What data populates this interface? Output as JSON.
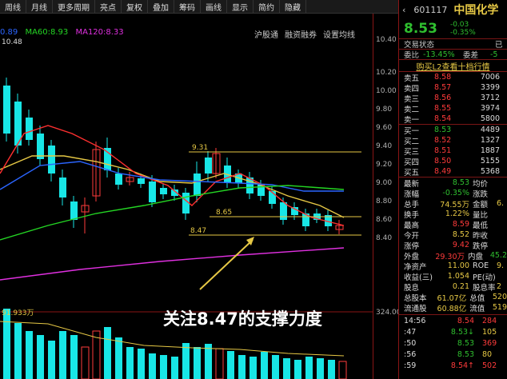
{
  "toolbar": {
    "items": [
      "周线",
      "月线",
      "更多周期",
      "亮点",
      "复权",
      "叠加",
      "筹码",
      "画线",
      "显示",
      "简约",
      "隐藏"
    ]
  },
  "indicators": {
    "ma5_value": "0.89",
    "ma60_label": "MA60:8.93",
    "ma120_label": "MA120:8.33",
    "high_marker": "10.48"
  },
  "chart_tools": [
    "沪股通",
    "融资融券",
    "设置均线"
  ],
  "price_axis": [
    "10.40",
    "10.20",
    "10.00",
    "9.80",
    "9.60",
    "9.40",
    "9.20",
    "9.00",
    "8.80",
    "8.60",
    "8.40"
  ],
  "level_labels": {
    "l931": "9.31",
    "l865": "8.65",
    "l847": "8.47"
  },
  "volume": {
    "label": "91.933万",
    "axis_top": "324.00"
  },
  "caption": {
    "text_a": "关注",
    "text_num": "8.47",
    "text_b": "的支撑力度"
  },
  "quote": {
    "code": "601117",
    "name": "中国化学",
    "last": "8.53",
    "change": "-0.03",
    "change_pct": "-0.35%",
    "status_label": "交易状态",
    "status_value": "已",
    "weibi_label": "委比",
    "weibi_value": "-13.45%",
    "weicha_label": "委差",
    "weicha_value": "-5",
    "level2_link": "购买L2查看十档行情",
    "asks": [
      {
        "label": "卖五",
        "price": "8.58",
        "vol": "7006"
      },
      {
        "label": "卖四",
        "price": "8.57",
        "vol": "3399"
      },
      {
        "label": "卖三",
        "price": "8.56",
        "vol": "3712"
      },
      {
        "label": "卖二",
        "price": "8.55",
        "vol": "3974"
      },
      {
        "label": "卖一",
        "price": "8.54",
        "vol": "5800"
      }
    ],
    "bids": [
      {
        "label": "买一",
        "price": "8.53",
        "vol": "4489"
      },
      {
        "label": "买二",
        "price": "8.52",
        "vol": "1327"
      },
      {
        "label": "买三",
        "price": "8.51",
        "vol": "1887"
      },
      {
        "label": "买四",
        "price": "8.50",
        "vol": "5155"
      },
      {
        "label": "买五",
        "price": "8.49",
        "vol": "5368"
      }
    ],
    "stats": [
      {
        "l1": "最新",
        "v1": "8.53",
        "l2": "均价",
        "v2": ""
      },
      {
        "l1": "涨幅",
        "v1": "-0.35%",
        "l2": "涨跌",
        "v2": ""
      },
      {
        "l1": "总手",
        "v1": "74.55万",
        "l2": "金额",
        "v2": "6."
      },
      {
        "l1": "换手",
        "v1": "1.22%",
        "l2": "量比",
        "v2": ""
      },
      {
        "l1": "最高",
        "v1": "8.59",
        "l2": "最低",
        "v2": ""
      },
      {
        "l1": "今开",
        "v1": "8.52",
        "l2": "昨收",
        "v2": ""
      },
      {
        "l1": "涨停",
        "v1": "9.42",
        "l2": "跌停",
        "v2": ""
      },
      {
        "l1": "外盘",
        "v1": "29.30万",
        "l2": "内盘",
        "v2": "45.2"
      },
      {
        "l1": "净资产",
        "v1": "11.00",
        "l2": "ROE",
        "v2": "9."
      },
      {
        "l1": "收益(三)",
        "v1": "1.054",
        "l2": "PE(动)",
        "v2": ""
      },
      {
        "l1": "股息",
        "v1": "0.21",
        "l2": "股息率",
        "v2": "2"
      },
      {
        "l1": "总股本",
        "v1": "61.07亿",
        "l2": "总值",
        "v2": "520"
      },
      {
        "l1": "流通股",
        "v1": "60.88亿",
        "l2": "流值",
        "v2": "519"
      }
    ],
    "ticks": [
      {
        "time": "14:56",
        "price": "8.54",
        "vol": "284"
      },
      {
        "time": ":47",
        "price": "8.53↓",
        "vol": "105"
      },
      {
        "time": ":50",
        "price": "8.53",
        "vol": "369"
      },
      {
        "time": ":56",
        "price": "8.53",
        "vol": "80"
      },
      {
        "time": ":59",
        "price": "8.54↑",
        "vol": "502"
      }
    ]
  },
  "colors": {
    "up": "#ff3b3b",
    "down": "#2fbf2f",
    "candle_cyan": "#18e6e6",
    "level_yellow": "#e6c845",
    "axis_red": "#8a1515"
  }
}
